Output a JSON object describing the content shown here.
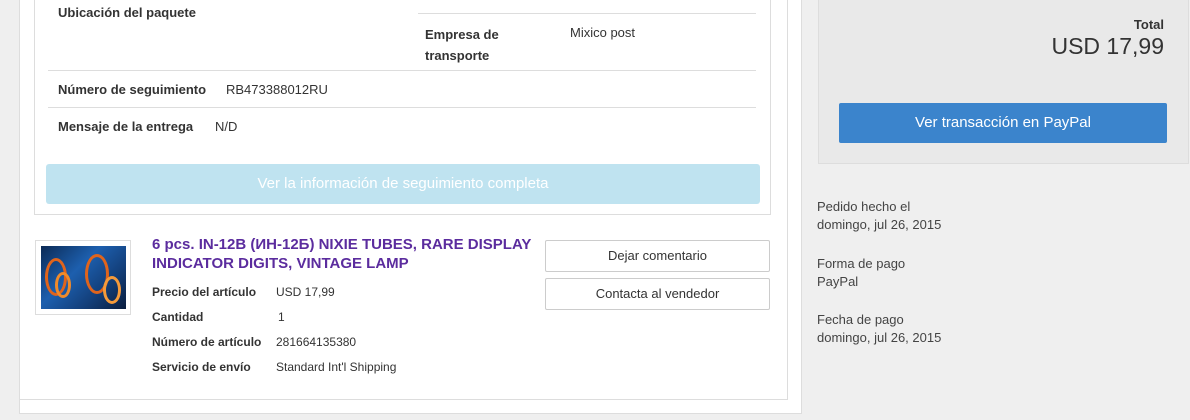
{
  "shipment": {
    "location_label": "Ubicación del paquete",
    "carrier_label_line1": "Empresa de",
    "carrier_label_line2": "transporte",
    "carrier_value": "Mixico post",
    "tracking_label": "Número de seguimiento",
    "tracking_value": "RB473388012RU",
    "delivery_msg_label": "Mensaje de la entrega",
    "delivery_msg_value": "N/D",
    "full_tracking_button": "Ver la información de seguimiento completa"
  },
  "item": {
    "image_icon": "nixie-tubes-photo",
    "title": "6 pcs. IN-12B (ИН-12Б) NIXIE TUBES, RARE DISPLAY INDICATOR DIGITS, VINTAGE LAMP",
    "price_label": "Precio del artículo",
    "price_value": "USD 17,99",
    "qty_label": "Cantidad",
    "qty_value": "1",
    "number_label": "Número de artículo",
    "number_value": "281664135380",
    "shipping_label": "Servicio de envío",
    "shipping_value": "Standard Int'l Shipping",
    "feedback_button": "Dejar comentario",
    "contact_button": "Contacta al vendedor"
  },
  "summary": {
    "total_label": "Total",
    "total_value": "USD 17,99",
    "paypal_button": "Ver transacción en PayPal"
  },
  "order_info": {
    "ordered_label": "Pedido hecho el",
    "ordered_value": "domingo, jul 26, 2015",
    "payment_method_label": "Forma de pago",
    "payment_method_value": "PayPal",
    "payment_date_label": "Fecha de pago",
    "payment_date_value": "domingo, jul 26, 2015"
  },
  "colors": {
    "item_title": "#5b2c9e",
    "paypal_button": "#3b84cc",
    "tracking_button_disabled": "#bfe3f0"
  }
}
